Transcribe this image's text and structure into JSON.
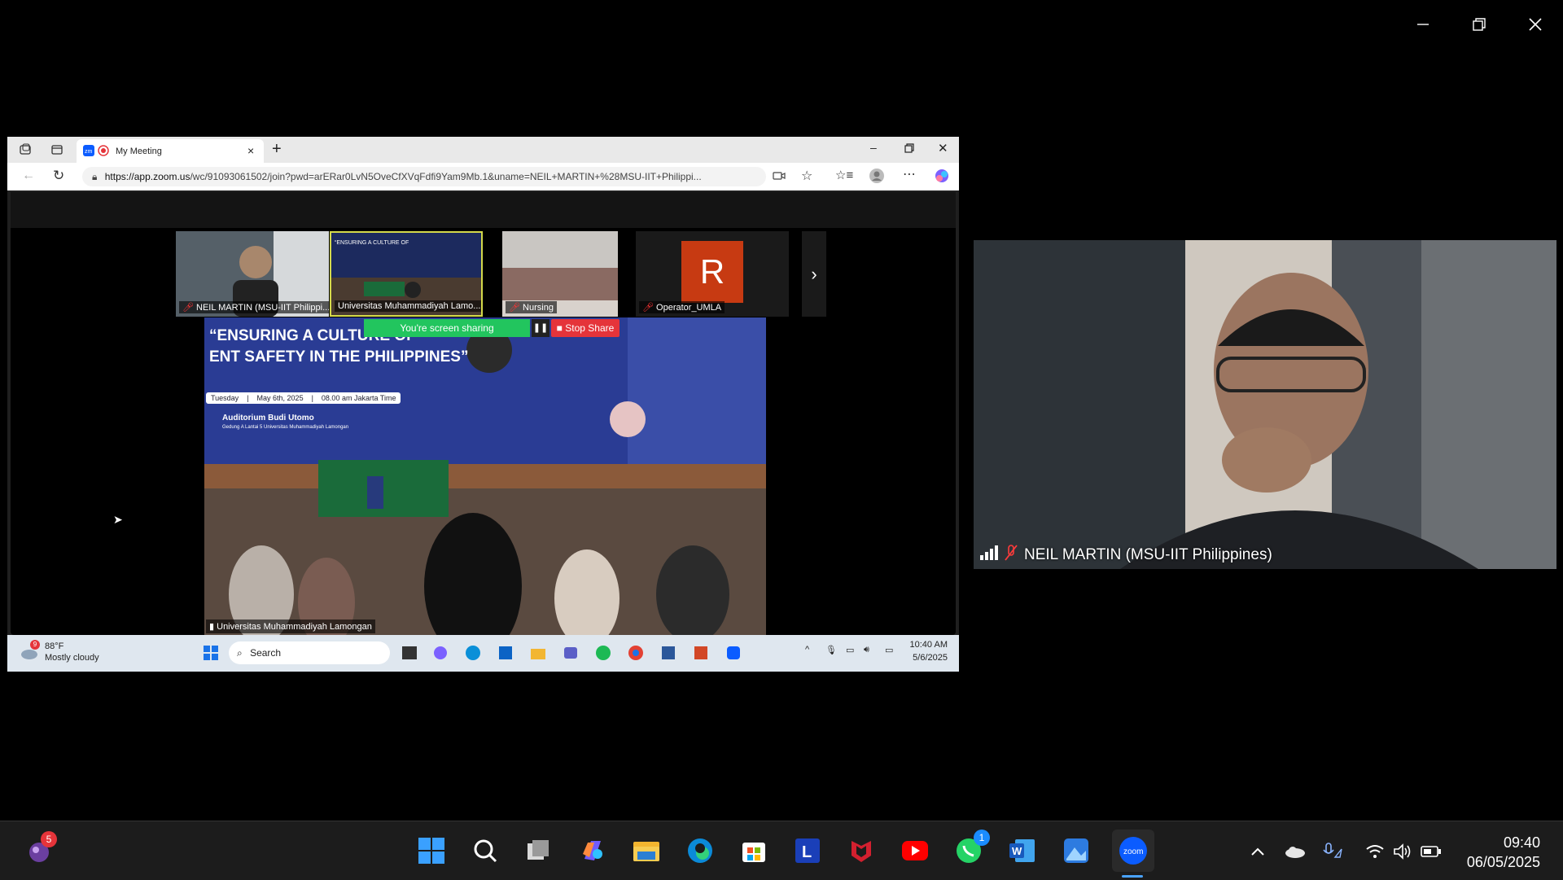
{
  "browser": {
    "tab_title": "My Meeting",
    "url_host": "https://app.zoom.us",
    "url_path": "/wc/91093061502/join?pwd=arERar0LvN5OveCfXVqFdfi9Yam9Mb.1&uname=NEIL+MARTIN+%28MSU-IIT+Philippi..."
  },
  "meeting": {
    "participants": [
      {
        "name": "NEIL MARTIN (MSU-IIT Philippi...",
        "muted": true
      },
      {
        "name": "Universitas Muhammadiyah Lamo...",
        "muted": false
      },
      {
        "name": "Nursing",
        "muted": true
      },
      {
        "name": "Operator_UMLA",
        "muted": true,
        "initial": "R"
      }
    ],
    "sharing_label": "You're screen sharing",
    "stop_share_label": "Stop Share",
    "shared_source_label": "Universitas Muhammadiyah Lamongan",
    "slide": {
      "title_line1": "“ENSURING A CULTURE OF",
      "title_line2": "ENT SAFETY IN THE PHILIPPINES”",
      "day": "Tuesday",
      "date": "May 6th, 2025",
      "time": "08.00 am Jakarta Time",
      "venue": "Auditorium Budi Utomo",
      "venue_sub": "Gedung A Lantai 5 Universitas Muhammadiyah Lamongan"
    }
  },
  "inner_taskbar": {
    "weather_temp": "88°F",
    "weather_desc": "Mostly cloudy",
    "weather_badge": "9",
    "search_placeholder": "Search",
    "time": "10:40 AM",
    "date": "5/6/2025"
  },
  "big_video": {
    "name": "NEIL MARTIN (MSU-IIT Philippines)"
  },
  "taskbar": {
    "notification_badge": "5",
    "whatsapp_badge": "1",
    "time": "09:40",
    "date": "06/05/2025",
    "icons": [
      "start-icon",
      "search-icon",
      "task-view-icon",
      "copilot-icon",
      "file-explorer-icon",
      "edge-icon",
      "store-icon",
      "l-app-icon",
      "mcafee-icon",
      "youtube-icon",
      "whatsapp-icon",
      "word-icon",
      "photos-icon",
      "zoom-icon"
    ]
  },
  "colors": {
    "sharing_green": "#22c55e",
    "stop_red": "#e5343a",
    "accent_blue": "#0b5cff"
  }
}
